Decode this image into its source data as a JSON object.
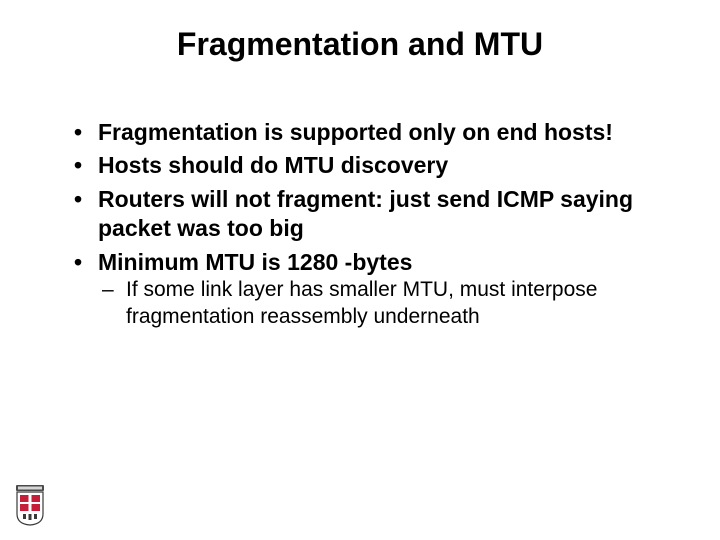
{
  "title": "Fragmentation and MTU",
  "bullets": {
    "b0": "Fragmentation is supported only on end hosts!",
    "b1": "Hosts should do MTU discovery",
    "b2": "Routers will not fragment: just send ICMP saying packet was too big",
    "b3": "Minimum MTU is 1280 -bytes",
    "s0": "If some link layer has smaller MTU, must interpose fragmentation reassembly underneath"
  }
}
